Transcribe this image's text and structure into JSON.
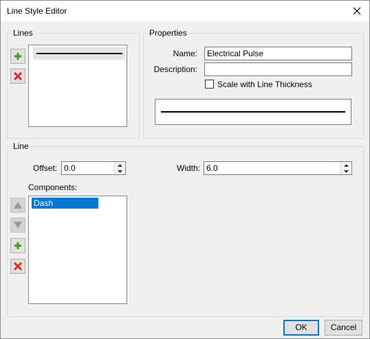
{
  "window": {
    "title": "Line Style Editor"
  },
  "lines_group": {
    "label": "Lines"
  },
  "properties_group": {
    "label": "Properties",
    "name_label": "Name:",
    "name_value": "Electrical Pulse",
    "description_label": "Description:",
    "description_value": "",
    "scale_label": "Scale with Line Thickness",
    "scale_checked": false
  },
  "line_group": {
    "label": "Line",
    "offset_label": "Offset:",
    "offset_value": "0.0",
    "width_label": "Width:",
    "width_value": "6.0",
    "components_label": "Components:",
    "components": [
      "Dash"
    ]
  },
  "buttons": {
    "ok": "OK",
    "cancel": "Cancel"
  },
  "colors": {
    "accent": "#0078d7",
    "add": "#3c9c1f",
    "remove": "#e32b22"
  }
}
